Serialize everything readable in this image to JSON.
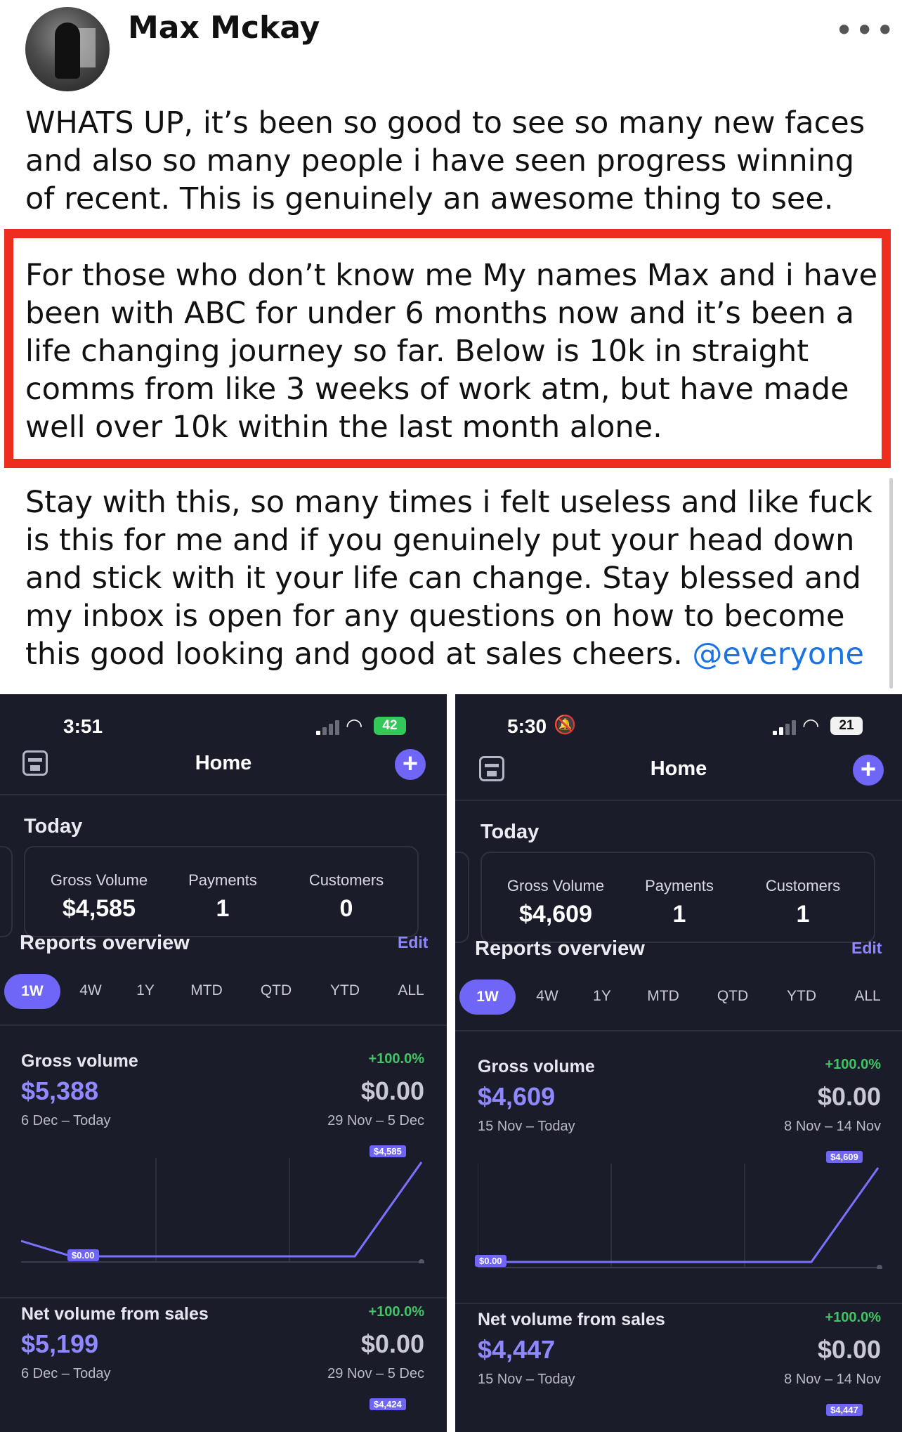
{
  "post": {
    "author": "Max Mckay",
    "more": "•••",
    "paragraph_1": "WHATS UP, it’s been so good to see so many new faces and also so many people i have seen progress winning of recent. This is genuinely an awesome thing to see.",
    "paragraph_2": "For those who don’t know me My names Max and i have been with ABC for under 6 months now and it’s been a life changing journey so far.  Below is 10k in straight comms from like 3 weeks of work atm, but have made well over 10k within the last month alone.",
    "paragraph_3": "Stay with this, so many times i felt useless and like fuck is this for me and if you genuinely put your head down and stick with it your life can change. Stay blessed and my inbox is open for any questions on how to become this good looking and good at sales cheers. ",
    "mention": "@everyone",
    "highlight_color": "#ef2d1e",
    "mention_color": "#1b74e4"
  },
  "screenshots": [
    {
      "status": {
        "time": "3:51",
        "battery": "42",
        "battery_style": "green",
        "bell_off": false
      },
      "nav": {
        "title": "Home"
      },
      "today": {
        "title": "Today",
        "stats": [
          {
            "label": "Gross Volume",
            "value": "$4,585"
          },
          {
            "label": "Payments",
            "value": "1"
          },
          {
            "label": "Customers",
            "value": "0"
          }
        ]
      },
      "reports": {
        "title": "Reports overview",
        "edit": "Edit",
        "ranges": [
          "1W",
          "4W",
          "1Y",
          "MTD",
          "QTD",
          "YTD",
          "ALL"
        ],
        "active_range": "1W"
      },
      "gross": {
        "name": "Gross volume",
        "change": "+100.0%",
        "value": "$5,388",
        "prev": "$0.00",
        "range": "6 Dec – Today",
        "prev_range": "29 Nov – 5 Dec",
        "tag_high": "$4,585",
        "tag_low": "$0.00"
      },
      "net": {
        "name": "Net volume from sales",
        "change": "+100.0%",
        "value": "$5,199",
        "prev": "$0.00",
        "range": "6 Dec – Today",
        "prev_range": "29 Nov – 5 Dec",
        "tag_high": "$4,424"
      }
    },
    {
      "status": {
        "time": "5:30",
        "battery": "21",
        "battery_style": "white",
        "bell_off": true
      },
      "nav": {
        "title": "Home"
      },
      "today": {
        "title": "Today",
        "stats": [
          {
            "label": "Gross Volume",
            "value": "$4,609"
          },
          {
            "label": "Payments",
            "value": "1"
          },
          {
            "label": "Customers",
            "value": "1"
          }
        ]
      },
      "reports": {
        "title": "Reports overview",
        "edit": "Edit",
        "ranges": [
          "1W",
          "4W",
          "1Y",
          "MTD",
          "QTD",
          "YTD",
          "ALL"
        ],
        "active_range": "1W"
      },
      "gross": {
        "name": "Gross volume",
        "change": "+100.0%",
        "value": "$4,609",
        "prev": "$0.00",
        "range": "15 Nov – Today",
        "prev_range": "8 Nov – 14 Nov",
        "tag_high": "$4,609",
        "tag_low": "$0.00"
      },
      "net": {
        "name": "Net volume from sales",
        "change": "+100.0%",
        "value": "$4,447",
        "prev": "$0.00",
        "range": "15 Nov – Today",
        "prev_range": "8 Nov – 14 Nov",
        "tag_high": "$4,447"
      }
    }
  ],
  "colors": {
    "app_bg": "#1b1c2a",
    "accent": "#6f66f7",
    "positive": "#41c464"
  }
}
